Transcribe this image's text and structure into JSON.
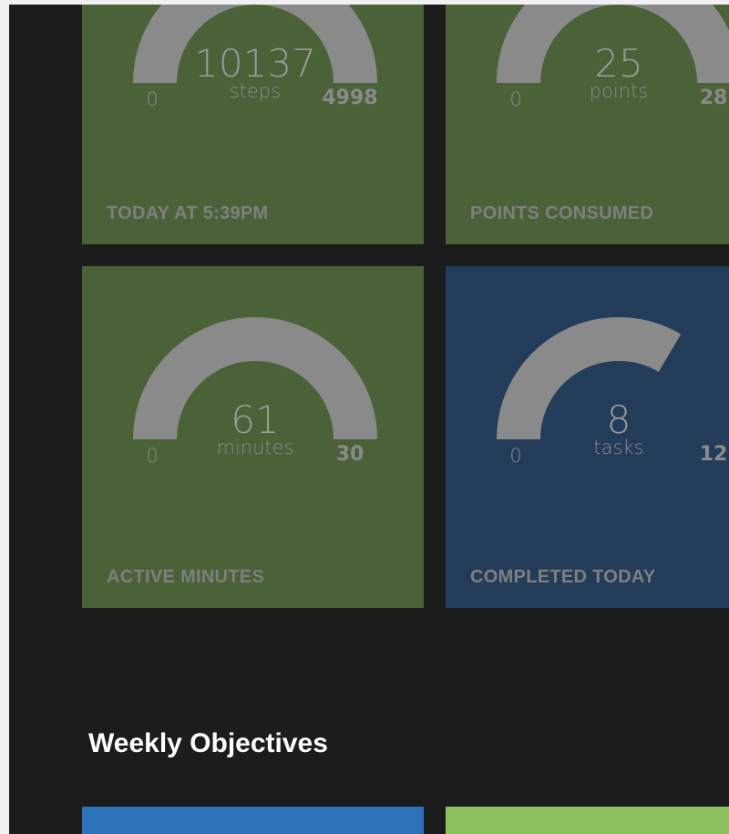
{
  "tiles": [
    {
      "value": "10137",
      "unit": "steps",
      "min": "0",
      "max": "4998",
      "progress": 1.0,
      "label": "TODAY AT 5:39PM",
      "color": "#4b6238"
    },
    {
      "value": "25",
      "unit": "points",
      "min": "0",
      "max": "28",
      "progress": 0.89,
      "label": "POINTS CONSUMED",
      "color": "#4b6238"
    },
    {
      "value": "61",
      "unit": "minutes",
      "min": "0",
      "max": "30",
      "progress": 1.0,
      "label": "ACTIVE MINUTES",
      "color": "#4b6238"
    },
    {
      "value": "8",
      "unit": "tasks",
      "min": "0",
      "max": "12",
      "progress": 0.67,
      "label": "COMPLETED TODAY",
      "color": "#233c59"
    }
  ],
  "weekly": {
    "title": "Weekly Objectives",
    "tile_colors": [
      "#2e72b8",
      "#8cc15e"
    ]
  },
  "colors": {
    "background": "#1c1c1c",
    "gauge": "#8a8a8a",
    "title": "#ffffff"
  }
}
